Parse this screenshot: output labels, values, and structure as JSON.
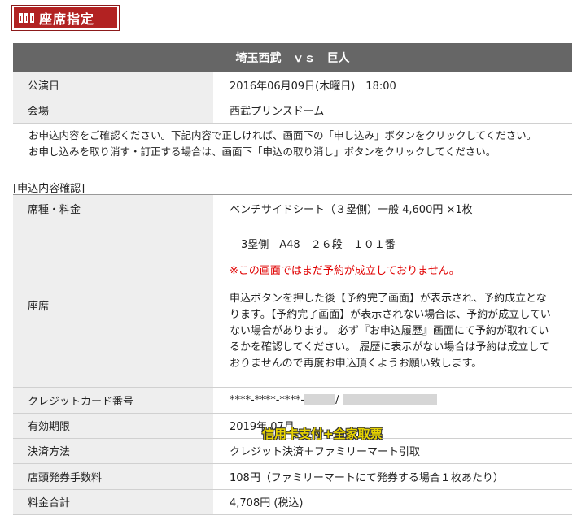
{
  "header": {
    "badge_label": "座席指定",
    "badge_icon": "seat-icon"
  },
  "event": {
    "title": "埼玉西武　ｖｓ　巨人"
  },
  "performance_rows": [
    {
      "label": "公演日",
      "value": "2016年06月09日(木曜日)　18:00"
    },
    {
      "label": "会場",
      "value": "西武プリンスドーム"
    }
  ],
  "notice": {
    "line1": "お申込内容をご確認ください。下記内容で正しければ、画面下の「申し込み」ボタンをクリックしてください。",
    "line2": "お申し込みを取り消す・訂正する場合は、画面下「申込の取り消し」ボタンをクリックしてください。"
  },
  "section": {
    "heading": "[申込内容確認]"
  },
  "details": {
    "seat_type_label": "席種・料金",
    "seat_type_value": "ベンチサイドシート（３塁側）一般 4,600円 ×1枚",
    "seat_label": "座席",
    "seat_position": "3塁側　A48　２６段　１０１番",
    "seat_warning": "※この画面ではまだ予約が成立しておりません。",
    "seat_instructions": "申込ボタンを押した後【予約完了画面】が表示され、予約成立となります。【予約完了画面】が表示されない場合は、予約が成立していない場合があります。 必ず『お申込履歴』画面にて予約が取れているかを確認してください。 履歴に表示がない場合は予約は成立しておりませんので再度お申込頂くようお願い致します。",
    "card_label": "クレジットカード番号",
    "card_value": "****-****-****-",
    "card_separator": "/",
    "expiry_label": "有効期限",
    "expiry_value": "2019年 07月",
    "payment_label": "決済方法",
    "payment_value": "クレジット決済＋ファミリーマート引取",
    "fee_label": "店頭発券手数料",
    "fee_value": "108円（ファミリーマートにて発券する場合１枚あたり）",
    "total_label": "料金合計",
    "total_value": "4,708円 (税込)"
  },
  "overlay": {
    "caption": "信用卡支付+全家取票",
    "color": "#e8d400"
  },
  "colors": {
    "badge_red": "#b22222",
    "title_bar": "#666666",
    "label_bg": "#eeeeee",
    "warning_red": "#e00000"
  }
}
